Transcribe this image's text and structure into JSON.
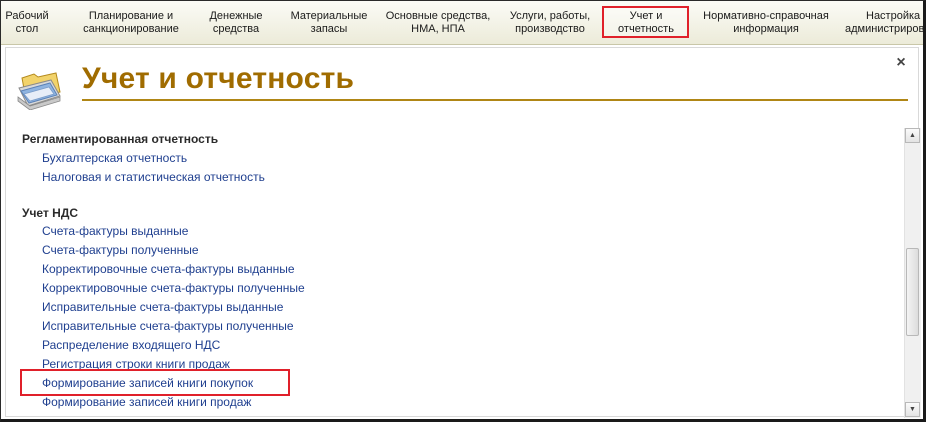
{
  "nav": {
    "items": [
      {
        "line1": "Рабочий",
        "line2": "стол"
      },
      {
        "line1": "Планирование и",
        "line2": "санкционирование"
      },
      {
        "line1": "Денежные",
        "line2": "средства"
      },
      {
        "line1": "Материальные",
        "line2": "запасы"
      },
      {
        "line1": "Основные средства,",
        "line2": "НМА, НПА"
      },
      {
        "line1": "Услуги, работы,",
        "line2": "производство"
      },
      {
        "line1": "Учет и",
        "line2": "отчетность"
      },
      {
        "line1": "Нормативно-справочная",
        "line2": "информация"
      },
      {
        "line1": "Настройка и",
        "line2": "администриров"
      }
    ],
    "active_index": 6
  },
  "page": {
    "title": "Учет и отчетность",
    "icon": "folder-documents-icon"
  },
  "groups": [
    {
      "title": "Регламентированная отчетность",
      "links": [
        "Бухгалтерская отчетность",
        "Налоговая и статистическая отчетность"
      ]
    },
    {
      "title": "Учет НДС",
      "links": [
        "Счета-фактуры выданные",
        "Счета-фактуры полученные",
        "Корректировочные счета-фактуры выданные",
        "Корректировочные счета-фактуры полученные",
        "Исправительные счета-фактуры выданные",
        "Исправительные счета-фактуры полученные",
        "Распределение входящего НДС",
        "Регистрация строки книги продаж",
        "Формирование записей книги покупок",
        "Формирование записей книги продаж"
      ]
    }
  ],
  "colors": {
    "title": "#a06c00",
    "link": "#1f3f8f",
    "highlight": "#e0202a"
  }
}
